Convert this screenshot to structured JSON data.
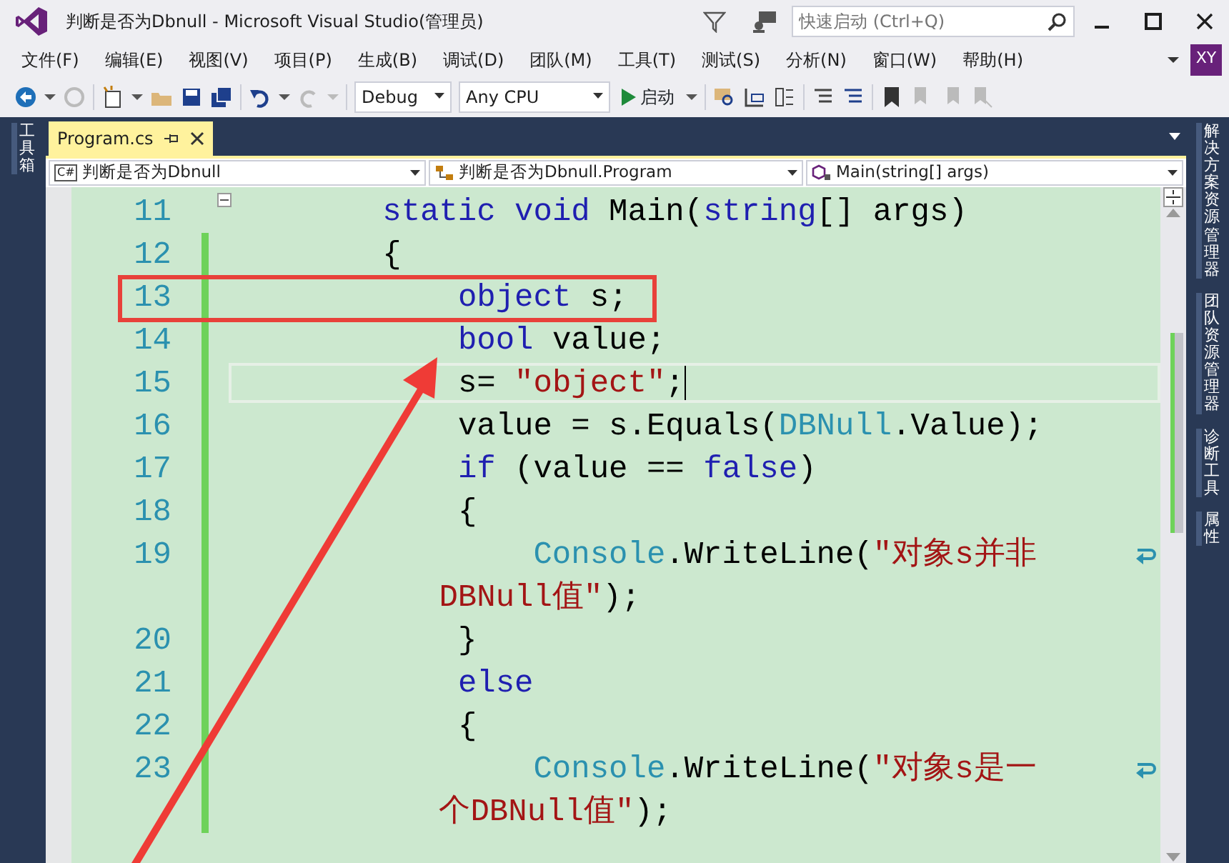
{
  "window": {
    "title": "判断是否为Dbnull - Microsoft Visual Studio(管理员)",
    "quick_launch": {
      "placeholder": "快速启动 (Ctrl+Q)"
    }
  },
  "menu": [
    "文件(F)",
    "编辑(E)",
    "视图(V)",
    "项目(P)",
    "生成(B)",
    "调试(D)",
    "团队(M)",
    "工具(T)",
    "测试(S)",
    "分析(N)",
    "窗口(W)",
    "帮助(H)"
  ],
  "user_badge": "XY",
  "toolbar": {
    "configuration": "Debug",
    "platform": "Any CPU",
    "start": "启动"
  },
  "left_tabs": [
    "工具箱"
  ],
  "right_tabs": [
    "解决方案资源管理器",
    "团队资源管理器",
    "诊断工具",
    "属性"
  ],
  "document_tabs": [
    {
      "label": "Program.cs",
      "selected": true
    }
  ],
  "navigation": [
    {
      "kind": "project",
      "badge": "C#",
      "label": "判断是否为Dbnull"
    },
    {
      "kind": "class",
      "label": "判断是否为Dbnull.Program"
    },
    {
      "kind": "method",
      "label": "Main(string[] args)"
    }
  ],
  "code": {
    "rows": [
      {
        "number": "11",
        "collapsible": true,
        "changed": false,
        "tokens": [
          {
            "kind": "keyword",
            "text": "        static void"
          },
          {
            "kind": "plain",
            "text": " Main("
          },
          {
            "kind": "keyword",
            "text": "string"
          },
          {
            "kind": "plain",
            "text": "[] args)"
          }
        ]
      },
      {
        "number": "12",
        "changed": true,
        "tokens": [
          {
            "kind": "plain",
            "text": "        {"
          }
        ]
      },
      {
        "number": "13",
        "changed": true,
        "tokens": [
          {
            "kind": "keyword",
            "text": "            object"
          },
          {
            "kind": "plain",
            "text": " s;"
          }
        ]
      },
      {
        "number": "14",
        "changed": true,
        "tokens": [
          {
            "kind": "keyword",
            "text": "            bool"
          },
          {
            "kind": "plain",
            "text": " value;"
          }
        ]
      },
      {
        "number": "15",
        "changed": true,
        "current": true,
        "tokens": [
          {
            "kind": "plain",
            "text": "            s= "
          },
          {
            "kind": "string",
            "text": "\"object\""
          },
          {
            "kind": "plain",
            "text": ";"
          }
        ]
      },
      {
        "number": "16",
        "changed": true,
        "tokens": [
          {
            "kind": "plain",
            "text": "            value = s.Equals("
          },
          {
            "kind": "type",
            "text": "DBNull"
          },
          {
            "kind": "plain",
            "text": ".Value);"
          }
        ]
      },
      {
        "number": "17",
        "changed": true,
        "tokens": [
          {
            "kind": "keyword",
            "text": "            if"
          },
          {
            "kind": "plain",
            "text": " (value == "
          },
          {
            "kind": "keyword",
            "text": "false"
          },
          {
            "kind": "plain",
            "text": ")"
          }
        ]
      },
      {
        "number": "18",
        "changed": true,
        "tokens": [
          {
            "kind": "plain",
            "text": "            {"
          }
        ]
      },
      {
        "number": "19",
        "changed": true,
        "wrapped": true,
        "tokens": [
          {
            "kind": "type",
            "text": "                Console"
          },
          {
            "kind": "plain",
            "text": ".WriteLine("
          },
          {
            "kind": "string",
            "text": "\"对象s并非"
          }
        ]
      },
      {
        "changed": true,
        "tokens": [
          {
            "kind": "string",
            "text": "           DBNull值\""
          },
          {
            "kind": "plain",
            "text": ");"
          }
        ]
      },
      {
        "number": "20",
        "changed": true,
        "tokens": [
          {
            "kind": "plain",
            "text": "            }"
          }
        ]
      },
      {
        "number": "21",
        "changed": true,
        "tokens": [
          {
            "kind": "keyword",
            "text": "            else"
          }
        ]
      },
      {
        "number": "22",
        "changed": true,
        "tokens": [
          {
            "kind": "plain",
            "text": "            {"
          }
        ]
      },
      {
        "number": "23",
        "changed": true,
        "wrapped": true,
        "tokens": [
          {
            "kind": "type",
            "text": "                Console"
          },
          {
            "kind": "plain",
            "text": ".WriteLine("
          },
          {
            "kind": "string",
            "text": "\"对象s是一"
          }
        ]
      },
      {
        "changed": true,
        "tokens": [
          {
            "kind": "string",
            "text": "           个DBNull值\""
          },
          {
            "kind": "plain",
            "text": ");"
          }
        ]
      }
    ]
  },
  "annotation": {
    "kind": "highlight-with-arrow"
  }
}
